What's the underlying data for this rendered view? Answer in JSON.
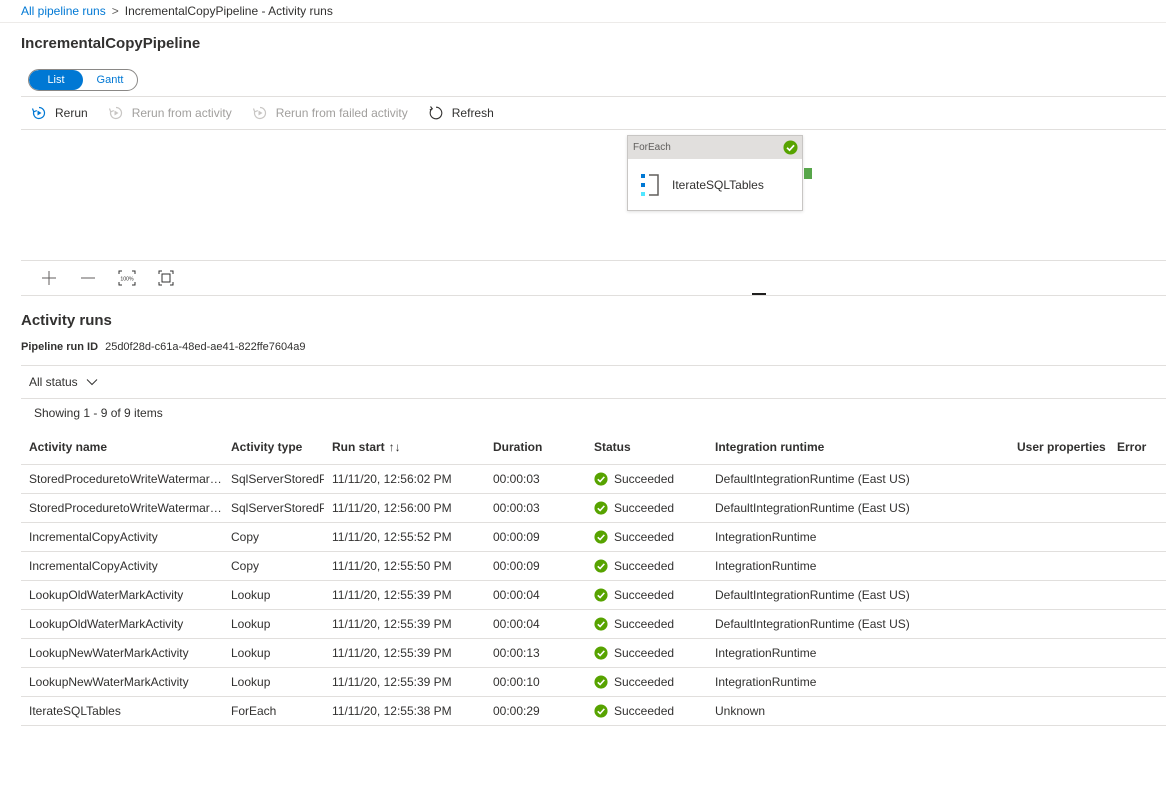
{
  "breadcrumb": {
    "root": "All pipeline runs",
    "separator": ">",
    "current": "IncrementalCopyPipeline - Activity runs"
  },
  "page_title": "IncrementalCopyPipeline",
  "view_toggle": {
    "list": "List",
    "gantt": "Gantt",
    "selected": "List"
  },
  "toolbar": {
    "rerun": "Rerun",
    "rerun_from_activity": "Rerun from activity",
    "rerun_from_failed": "Rerun from failed activity",
    "refresh": "Refresh"
  },
  "canvas": {
    "node": {
      "type": "ForEach",
      "name": "IterateSQLTables",
      "status": "succeeded"
    }
  },
  "zoom_controls": {
    "fit_label": "100%"
  },
  "activity_runs": {
    "title": "Activity runs",
    "run_id_label": "Pipeline run ID",
    "run_id": "25d0f28d-c61a-48ed-ae41-822ffe7604a9",
    "filter": "All status",
    "showing": "Showing 1 - 9 of 9 items",
    "columns": {
      "name": "Activity name",
      "type": "Activity type",
      "run_start": "Run start",
      "sort_glyph": "↑↓",
      "duration": "Duration",
      "status": "Status",
      "runtime": "Integration runtime",
      "user_props": "User properties",
      "error": "Error"
    },
    "rows": [
      {
        "name": "StoredProceduretoWriteWatermarkActivity",
        "type": "SqlServerStoredProcedure",
        "start": "11/11/20, 12:56:02 PM",
        "duration": "00:00:03",
        "status": "Succeeded",
        "runtime": "DefaultIntegrationRuntime (East US)"
      },
      {
        "name": "StoredProceduretoWriteWatermarkActivity",
        "type": "SqlServerStoredProcedure",
        "start": "11/11/20, 12:56:00 PM",
        "duration": "00:00:03",
        "status": "Succeeded",
        "runtime": "DefaultIntegrationRuntime (East US)"
      },
      {
        "name": "IncrementalCopyActivity",
        "type": "Copy",
        "start": "11/11/20, 12:55:52 PM",
        "duration": "00:00:09",
        "status": "Succeeded",
        "runtime": "IntegrationRuntime"
      },
      {
        "name": "IncrementalCopyActivity",
        "type": "Copy",
        "start": "11/11/20, 12:55:50 PM",
        "duration": "00:00:09",
        "status": "Succeeded",
        "runtime": "IntegrationRuntime"
      },
      {
        "name": "LookupOldWaterMarkActivity",
        "type": "Lookup",
        "start": "11/11/20, 12:55:39 PM",
        "duration": "00:00:04",
        "status": "Succeeded",
        "runtime": "DefaultIntegrationRuntime (East US)"
      },
      {
        "name": "LookupOldWaterMarkActivity",
        "type": "Lookup",
        "start": "11/11/20, 12:55:39 PM",
        "duration": "00:00:04",
        "status": "Succeeded",
        "runtime": "DefaultIntegrationRuntime (East US)"
      },
      {
        "name": "LookupNewWaterMarkActivity",
        "type": "Lookup",
        "start": "11/11/20, 12:55:39 PM",
        "duration": "00:00:13",
        "status": "Succeeded",
        "runtime": "IntegrationRuntime"
      },
      {
        "name": "LookupNewWaterMarkActivity",
        "type": "Lookup",
        "start": "11/11/20, 12:55:39 PM",
        "duration": "00:00:10",
        "status": "Succeeded",
        "runtime": "IntegrationRuntime"
      },
      {
        "name": "IterateSQLTables",
        "type": "ForEach",
        "start": "11/11/20, 12:55:38 PM",
        "duration": "00:00:29",
        "status": "Succeeded",
        "runtime": "Unknown"
      }
    ]
  },
  "colors": {
    "accent": "#0078d4",
    "success": "#57a300",
    "disabled": "#a19f9d"
  }
}
